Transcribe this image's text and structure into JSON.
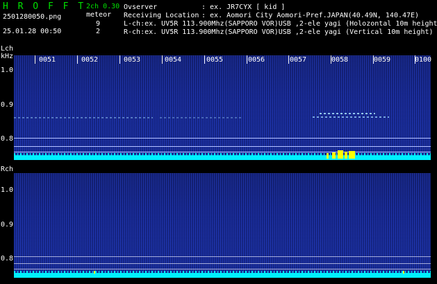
{
  "header": {
    "logo": "H R O F F T",
    "version": "2ch 0.30",
    "filename": "2501280050.png",
    "datetime": "25.01.28 00:50",
    "meteor_label": "meteor",
    "meteor_l_count": "9",
    "meteor_r_count": "2",
    "observer_label": "Ovserver",
    "observer_value": ": ex. JR7CYX [ kid ]",
    "location_label": "Receiving Location",
    "location_value": ": ex. Aomori City Aomori-Pref.JAPAN(40.49N, 140.47E)",
    "lch_info": "L-ch:ex. UV5R 113.900Mhz(SAPPORO VOR)USB ,2-ele yagi (Holozontal 10m height)",
    "rch_info": "R-ch:ex. UV5R 113.900Mhz(SAPPORO VOR)USB ,2-ele yagi (Vertical 10m height)"
  },
  "time_axis": [
    "0051",
    "0052",
    "0053",
    "0054",
    "0055",
    "0056",
    "0057",
    "0058",
    "0059",
    "0100"
  ],
  "left_channel": {
    "name": "Lch",
    "unit": "kHz",
    "y_ticks": [
      "1.0",
      "0.9",
      "0.8"
    ]
  },
  "right_channel": {
    "name": "Rch",
    "y_ticks": [
      "1.0",
      "0.9",
      "0.8"
    ]
  },
  "colors": {
    "header_green": "#00e000",
    "spectrogram_bg": "#10228a",
    "noise_band": "#00f0ff",
    "meteor_echo": "#ffff00"
  }
}
